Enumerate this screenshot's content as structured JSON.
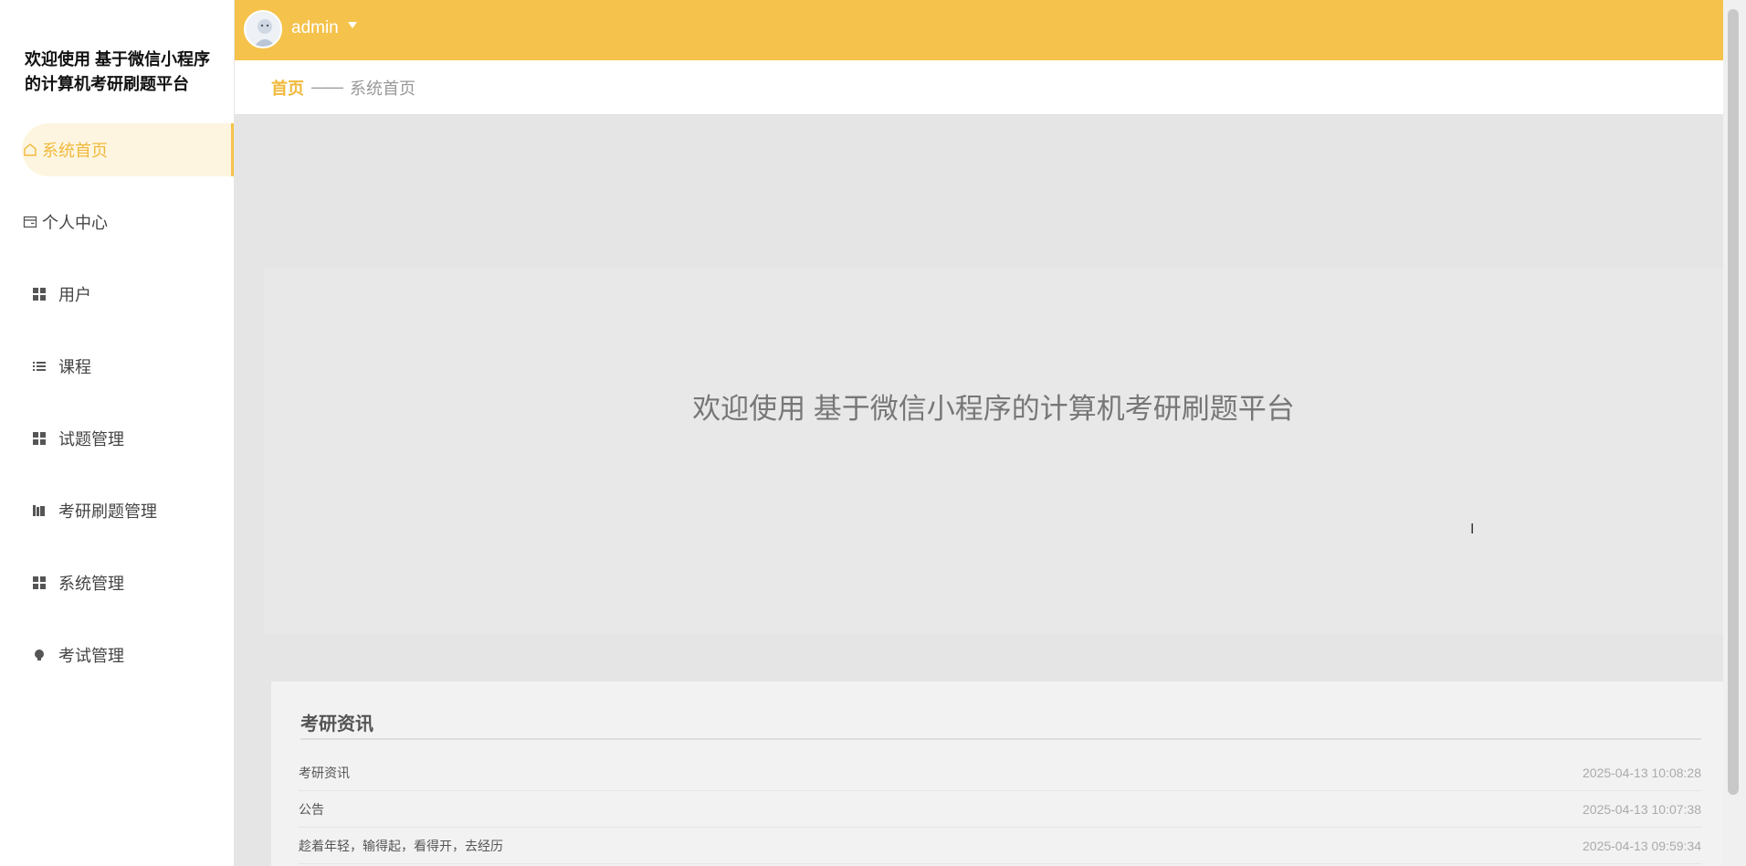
{
  "sidebar": {
    "brand": "欢迎使用 基于微信小程序的计算机考研刷题平台",
    "items": [
      {
        "label": "系统首页",
        "icon": "home-icon"
      },
      {
        "label": "个人中心",
        "icon": "card-icon"
      },
      {
        "label": "用户",
        "icon": "grid-icon"
      },
      {
        "label": "课程",
        "icon": "list-icon"
      },
      {
        "label": "试题管理",
        "icon": "grid-icon"
      },
      {
        "label": "考研刷题管理",
        "icon": "library-icon"
      },
      {
        "label": "系统管理",
        "icon": "grid-icon"
      },
      {
        "label": "考试管理",
        "icon": "bulb-icon"
      }
    ]
  },
  "topbar": {
    "username": "admin"
  },
  "breadcrumb": {
    "home": "首页",
    "separator": "——",
    "current": "系统首页"
  },
  "main": {
    "welcome": "欢迎使用 基于微信小程序的计算机考研刷题平台",
    "news": {
      "title": "考研资讯",
      "rows": [
        {
          "title": "考研资讯",
          "date": "2025-04-13 10:08:28"
        },
        {
          "title": "公告",
          "date": "2025-04-13 10:07:38"
        },
        {
          "title": "趁着年轻，输得起，看得开，去经历",
          "date": "2025-04-13 09:59:34"
        }
      ]
    }
  },
  "colors": {
    "accent": "#f5c24b",
    "active_bg": "#fdf5df",
    "active_text": "#f0b93c"
  }
}
